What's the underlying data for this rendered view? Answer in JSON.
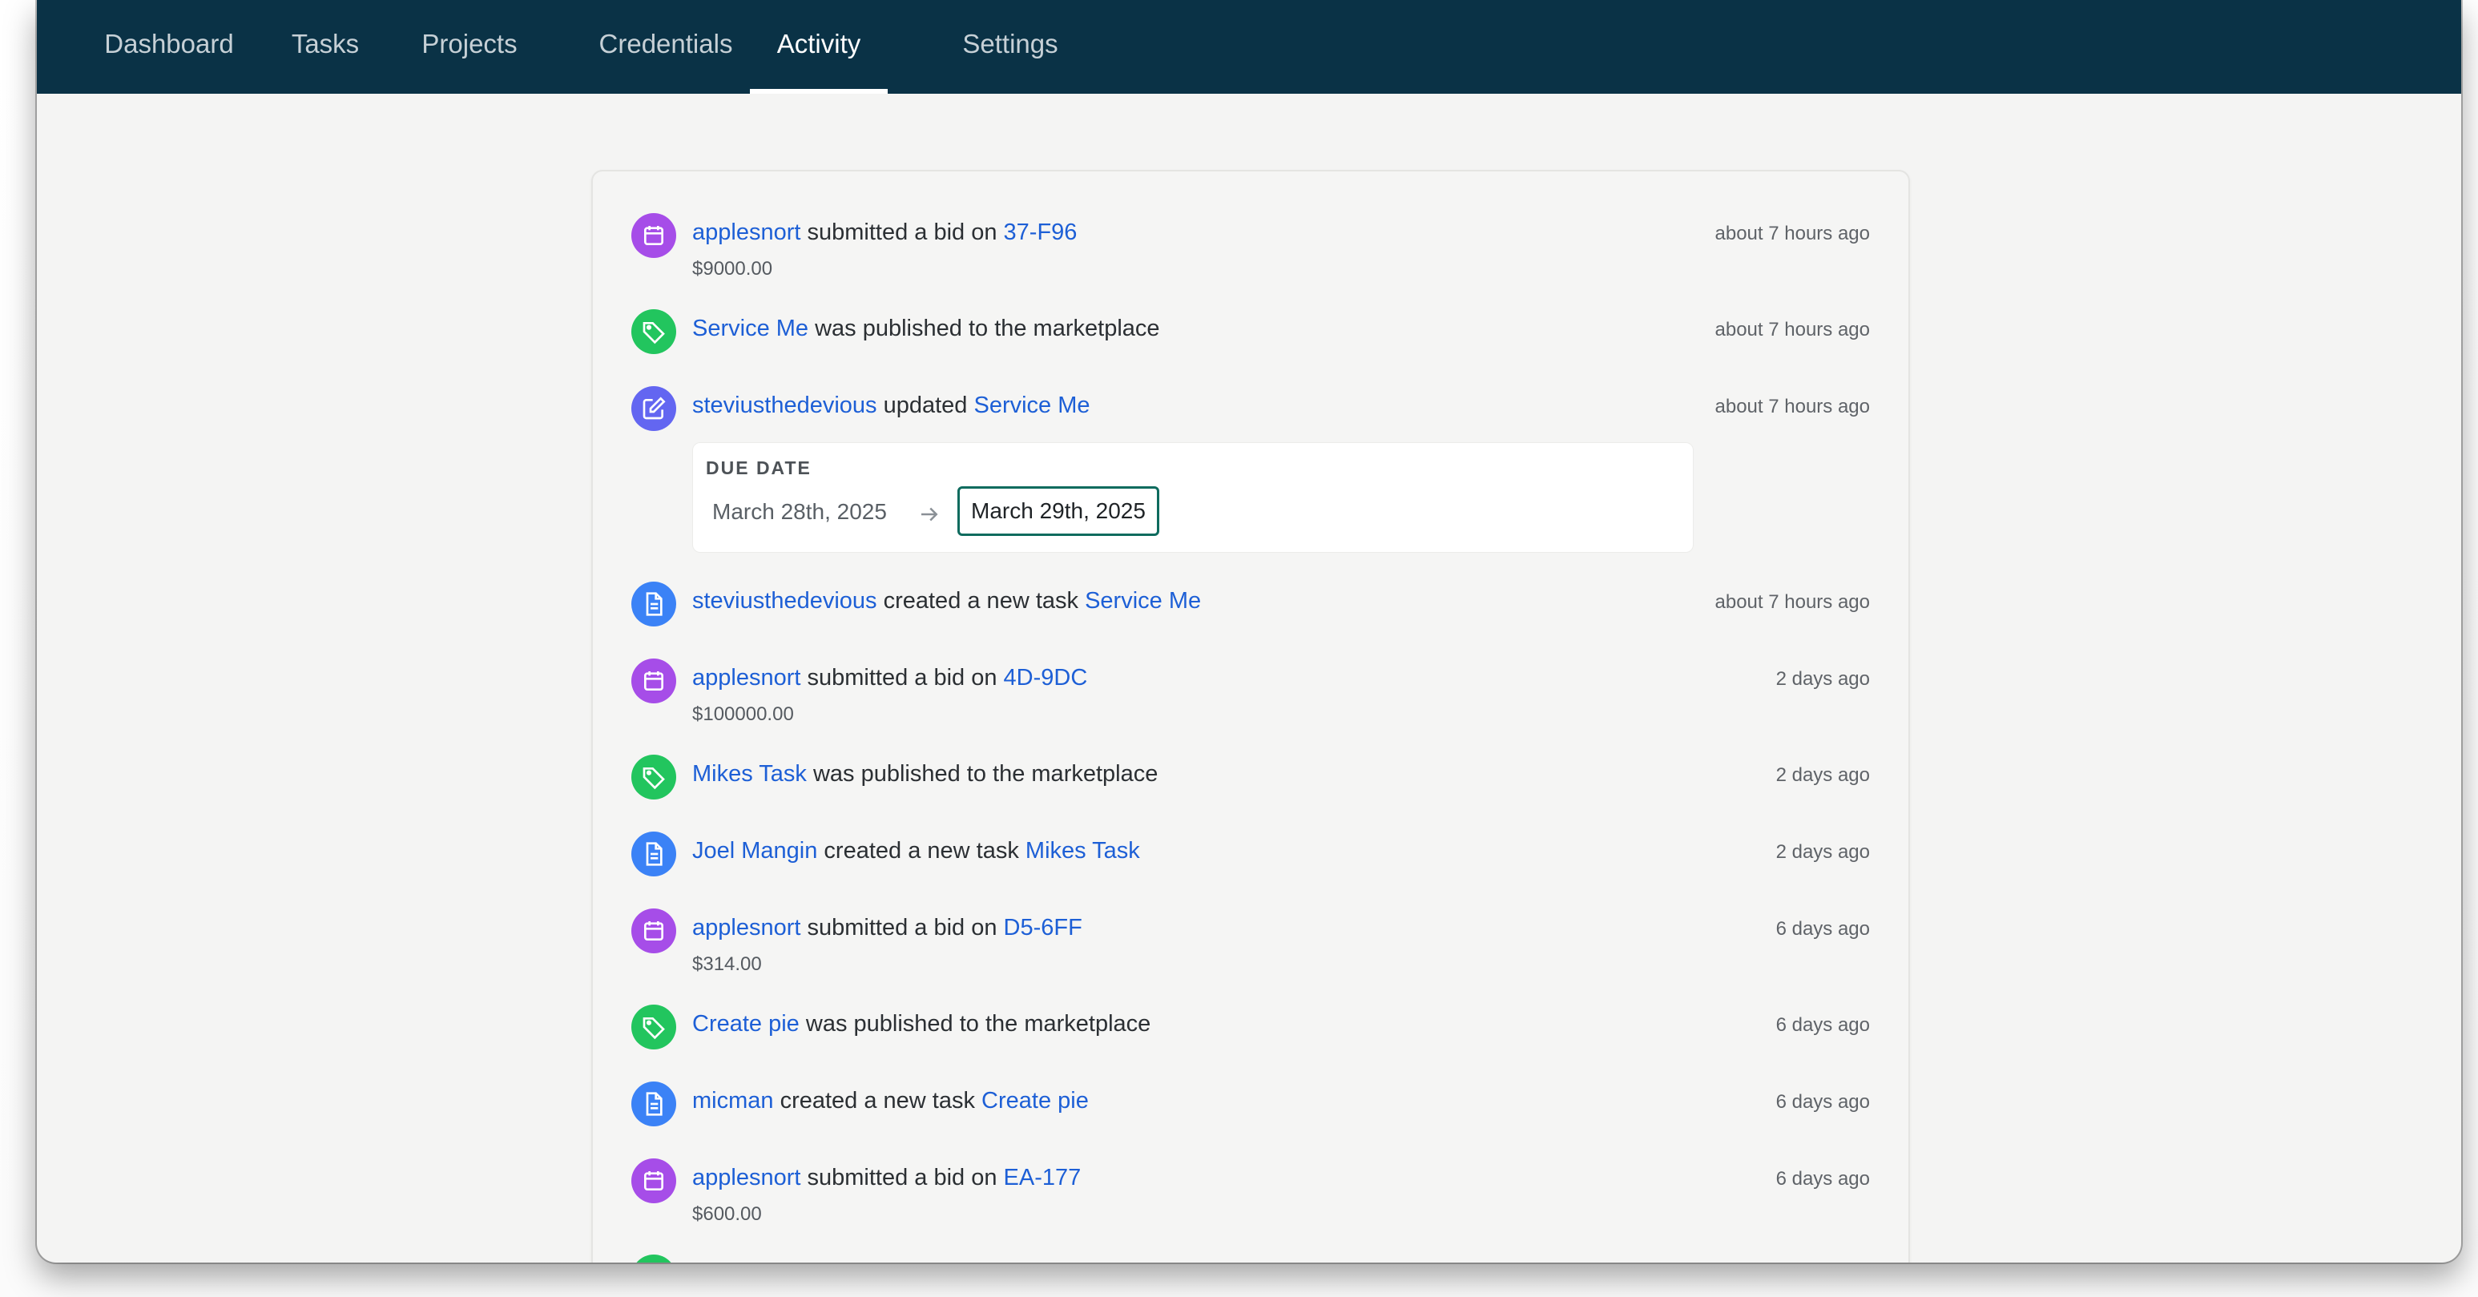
{
  "nav": {
    "items": [
      {
        "label": "Dashboard",
        "active": false
      },
      {
        "label": "Tasks",
        "active": false
      },
      {
        "label": "Projects",
        "active": false
      },
      {
        "label": "Credentials",
        "active": false
      },
      {
        "label": "Activity",
        "active": true
      },
      {
        "label": "Settings",
        "active": false
      }
    ]
  },
  "activity": {
    "entries": [
      {
        "icon": "calendar-icon",
        "color": "#a64de8",
        "actor": "applesnort",
        "text": " submitted a bid on ",
        "target": "37-F96",
        "sub": "$9000.00",
        "time": "about 7 hours ago"
      },
      {
        "icon": "tag-icon",
        "color": "#22c55e",
        "actor": "Service Me",
        "text": " was published to the marketplace",
        "time": "about 7 hours ago"
      },
      {
        "icon": "edit-icon",
        "color": "#6366f1",
        "actor": "steviusthedevious",
        "text": " updated ",
        "target": "Service Me",
        "time": "about 7 hours ago",
        "change": {
          "label": "DUE DATE",
          "old": "March 28th, 2025",
          "new": "March 29th, 2025"
        }
      },
      {
        "icon": "document-icon",
        "color": "#3b82f6",
        "actor": "steviusthedevious",
        "text": " created a new task ",
        "target": "Service Me",
        "time": "about 7 hours ago"
      },
      {
        "icon": "calendar-icon",
        "color": "#a64de8",
        "actor": "applesnort",
        "text": " submitted a bid on ",
        "target": "4D-9DC",
        "sub": "$100000.00",
        "time": "2 days ago"
      },
      {
        "icon": "tag-icon",
        "color": "#22c55e",
        "actor": "Mikes Task",
        "text": " was published to the marketplace",
        "time": "2 days ago"
      },
      {
        "icon": "document-icon",
        "color": "#3b82f6",
        "actor": "Joel Mangin",
        "text": " created a new task ",
        "target": "Mikes Task",
        "time": "2 days ago"
      },
      {
        "icon": "calendar-icon",
        "color": "#a64de8",
        "actor": "applesnort",
        "text": " submitted a bid on ",
        "target": "D5-6FF",
        "sub": "$314.00",
        "time": "6 days ago"
      },
      {
        "icon": "tag-icon",
        "color": "#22c55e",
        "actor": "Create pie",
        "text": " was published to the marketplace",
        "time": "6 days ago"
      },
      {
        "icon": "document-icon",
        "color": "#3b82f6",
        "actor": "micman",
        "text": " created a new task ",
        "target": "Create pie",
        "time": "6 days ago"
      },
      {
        "icon": "calendar-icon",
        "color": "#a64de8",
        "actor": "applesnort",
        "text": " submitted a bid on ",
        "target": "EA-177",
        "sub": "$600.00",
        "time": "6 days ago"
      }
    ]
  }
}
